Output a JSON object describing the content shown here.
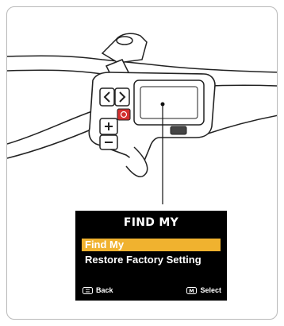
{
  "screen": {
    "title": "FIND MY",
    "menu": [
      {
        "label": "Find My",
        "selected": true
      },
      {
        "label": "Restore Factory Setting",
        "selected": false
      }
    ],
    "footer": {
      "back_label": "Back",
      "select_label": "Select",
      "select_key": "M"
    }
  },
  "colors": {
    "highlight": "#f0b22f",
    "screen_bg": "#000000",
    "power_button": "#d32f2f"
  },
  "icons": [
    "back-button-icon",
    "m-button-icon",
    "chevron-left-icon",
    "chevron-right-icon",
    "plus-icon",
    "minus-icon",
    "power-icon"
  ]
}
